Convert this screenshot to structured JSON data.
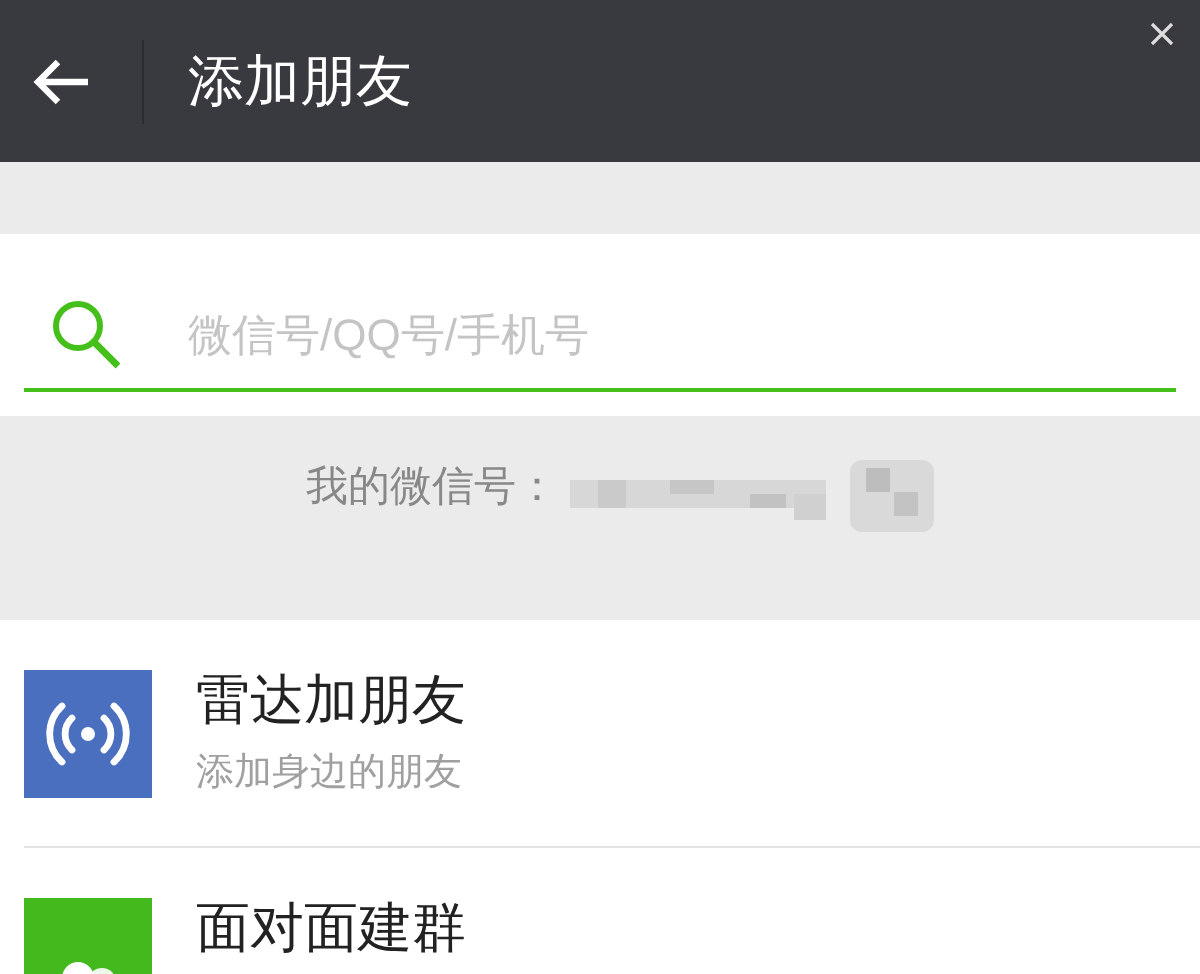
{
  "header": {
    "title": "添加朋友"
  },
  "search": {
    "placeholder": "微信号/QQ号/手机号"
  },
  "my_id": {
    "label": "我的微信号："
  },
  "items": [
    {
      "kind": "radar",
      "color": "#4a6fbf",
      "title": "雷达加朋友",
      "subtitle": "添加身边的朋友"
    },
    {
      "kind": "group",
      "color": "#44b91e",
      "title": "面对面建群"
    }
  ]
}
